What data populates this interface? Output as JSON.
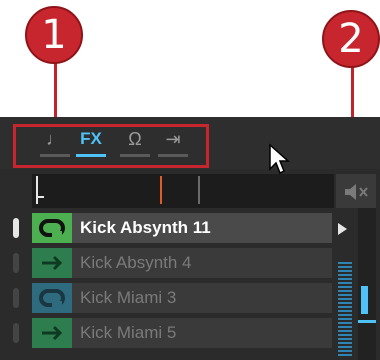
{
  "callouts": [
    {
      "label": "1"
    },
    {
      "label": "2"
    }
  ],
  "tabs": [
    {
      "name": "sample",
      "glyph": "♩",
      "active": false
    },
    {
      "name": "fx",
      "glyph": "FX",
      "active": true
    },
    {
      "name": "headphones",
      "glyph": "Ω",
      "active": false
    },
    {
      "name": "routing",
      "glyph": "⇥",
      "active": false
    }
  ],
  "mute_icon": "speaker-mute-icon",
  "slots": [
    {
      "label": "Kick Absynth 11",
      "mode": "loop",
      "color": "#4caf50",
      "selected": true
    },
    {
      "label": "Kick Absynth 4",
      "mode": "one-shot",
      "color": "#2e7d4f",
      "selected": false
    },
    {
      "label": "Kick Miami 3",
      "mode": "loop",
      "color": "#2e6b7f",
      "selected": false
    },
    {
      "label": "Kick Miami 5",
      "mode": "one-shot",
      "color": "#2e7d4f",
      "selected": false
    }
  ],
  "colors": {
    "accent": "#4fc3f7",
    "callout": "#c8262e",
    "playhead": "#e05a2a"
  }
}
